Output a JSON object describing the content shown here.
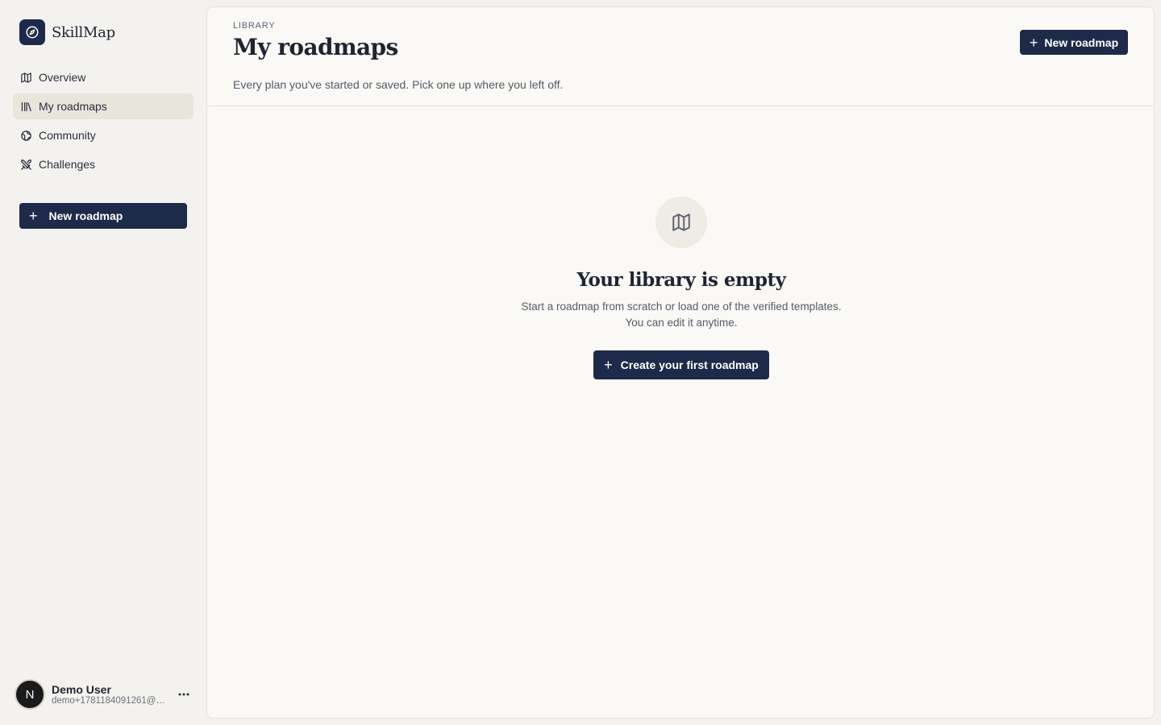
{
  "brand": {
    "name": "SkillMap",
    "logo_icon": "compass-icon"
  },
  "sidebar": {
    "items": [
      {
        "label": "Overview",
        "icon": "map-icon",
        "active": false
      },
      {
        "label": "My roadmaps",
        "icon": "library-icon",
        "active": true
      },
      {
        "label": "Community",
        "icon": "globe-icon",
        "active": false
      },
      {
        "label": "Challenges",
        "icon": "swords-icon",
        "active": false
      }
    ],
    "new_button_label": "New roadmap"
  },
  "user": {
    "initial": "N",
    "name": "Demo User",
    "email": "demo+1781184091261@s..."
  },
  "header": {
    "eyebrow": "LIBRARY",
    "title": "My roadmaps",
    "subtitle": "Every plan you've started or saved. Pick one up where you left off.",
    "new_button_label": "New roadmap"
  },
  "empty_state": {
    "icon": "map-icon",
    "title": "Your library is empty",
    "description_line1": "Start a roadmap from scratch or load one of the verified templates.",
    "description_line2": "You can edit it anytime.",
    "cta_label": "Create your first roadmap"
  },
  "colors": {
    "accent": "#1e2a4a",
    "background": "#f4f2ee",
    "panel": "#faf9f6",
    "active_nav": "#e8e5dd"
  }
}
